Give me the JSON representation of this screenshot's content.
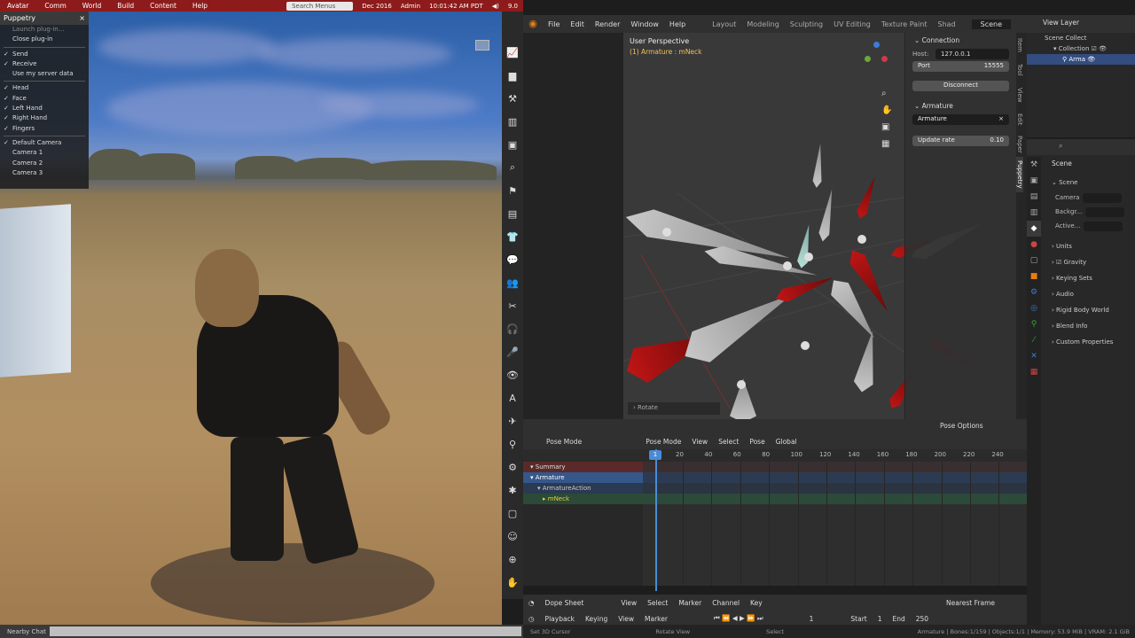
{
  "sl": {
    "menu": [
      "Avatar",
      "Comm",
      "World",
      "Build",
      "Content",
      "Help"
    ],
    "search_placeholder": "Search Menus",
    "date": "Dec 2016",
    "user": "Admin",
    "time": "10:01:42 AM PDT",
    "version": "9.0",
    "puppetry": {
      "title": "Puppetry",
      "close": "×",
      "items": [
        {
          "label": "Launch plug-in...",
          "checked": false,
          "dim": true
        },
        {
          "label": "Close plug-in",
          "checked": false,
          "dim": false
        },
        {
          "sep": true
        },
        {
          "label": "Send",
          "checked": true
        },
        {
          "label": "Receive",
          "checked": true
        },
        {
          "label": "Use my server data",
          "checked": false
        },
        {
          "sep": true
        },
        {
          "label": "Head",
          "checked": true
        },
        {
          "label": "Face",
          "checked": true
        },
        {
          "label": "Left Hand",
          "checked": true
        },
        {
          "label": "Right Hand",
          "checked": true
        },
        {
          "label": "Fingers",
          "checked": true
        },
        {
          "sep": true
        },
        {
          "label": "Default Camera",
          "checked": true
        },
        {
          "label": "Camera 1",
          "checked": false
        },
        {
          "label": "Camera 2",
          "checked": false
        },
        {
          "label": "Camera 3",
          "checked": false
        }
      ]
    },
    "toolbar_icons": [
      "chart-icon",
      "chat-bubble-icon",
      "build-icon",
      "map-icon",
      "minimap-icon",
      "search-icon",
      "tools-icon",
      "inventory-icon",
      "clothing-icon",
      "speech-icon",
      "people-icon",
      "move-icon",
      "headset-icon",
      "voice-icon",
      "view-icon",
      "appearance-icon",
      "places-icon",
      "walk-icon",
      "gear-icon",
      "bug-icon",
      "snapshot-icon",
      "avatar-icon",
      "zoom-icon",
      "hand-icon"
    ],
    "toolbar_glyphs": [
      "📈",
      "▆",
      "⚒",
      "▥",
      "▣",
      "⌕",
      "⚑",
      "▤",
      "👕",
      "💬",
      "👥",
      "✂",
      "🎧",
      "🎤",
      "👁",
      "A",
      "✈",
      "⚲",
      "⚙",
      "✱",
      "▢",
      "☺",
      "⊕",
      "✋"
    ],
    "chat_label": "Nearby Chat"
  },
  "blender": {
    "menu": [
      "File",
      "Edit",
      "Render",
      "Window",
      "Help"
    ],
    "workspaces": [
      "Layout",
      "Modeling",
      "Sculpting",
      "UV Editing",
      "Texture Paint",
      "Shad"
    ],
    "scene_name": "Scene",
    "view_layer": "View Layer",
    "viewport": {
      "title": "User Perspective",
      "subtitle": "(1) Armature : mNeck",
      "operator": "Rotate"
    },
    "npanel": {
      "connection": "Connection",
      "host_label": "Host:",
      "host": "127.0.0.1",
      "port_label": "Port",
      "port": "15555",
      "disconnect": "Disconnect",
      "armature_section": "Armature",
      "armature_name": "Armature",
      "update_label": "Update rate",
      "update_value": "0.10",
      "tabs": [
        "Item",
        "Tool",
        "View",
        "Edit",
        "Paper",
        "Puppetry"
      ]
    },
    "outliner": {
      "rows": [
        "Scene Collect",
        "Collection",
        "Arma"
      ]
    },
    "properties": {
      "header": "Scene",
      "section": "Scene",
      "fields": [
        "Camera",
        "Backgr...",
        "Active..."
      ],
      "panels": [
        "Units",
        "Gravity",
        "Keying Sets",
        "Audio",
        "Rigid Body World",
        "Blend Info",
        "Custom Properties"
      ]
    },
    "dopesheet": {
      "mode": "Pose Mode",
      "menu": [
        "View",
        "Select",
        "Pose"
      ],
      "transform": "Global",
      "pose_options": "Pose Options",
      "channels": [
        "Summary",
        "Armature",
        "ArmatureAction",
        "mNeck"
      ],
      "ticks": [
        "20",
        "40",
        "60",
        "80",
        "100",
        "120",
        "140",
        "160",
        "180",
        "200",
        "220",
        "240"
      ],
      "frame": "1",
      "footer_mode": "Dope Sheet",
      "footer_menu": [
        "View",
        "Select",
        "Marker",
        "Channel",
        "Key"
      ],
      "snap": "Nearest Frame"
    },
    "timeline": {
      "menu": [
        "Playback",
        "Keying",
        "View",
        "Marker"
      ],
      "current": "1",
      "start_label": "Start",
      "start": "1",
      "end_label": "End",
      "end": "250"
    },
    "status": {
      "left": "Set 3D Cursor",
      "mid": "Rotate View",
      "mid2": "Select",
      "right": "Armature | Bones:1/159 | Objects:1/1 | Memory: 53.9 MiB | VRAM: 2.1 GiB"
    }
  }
}
